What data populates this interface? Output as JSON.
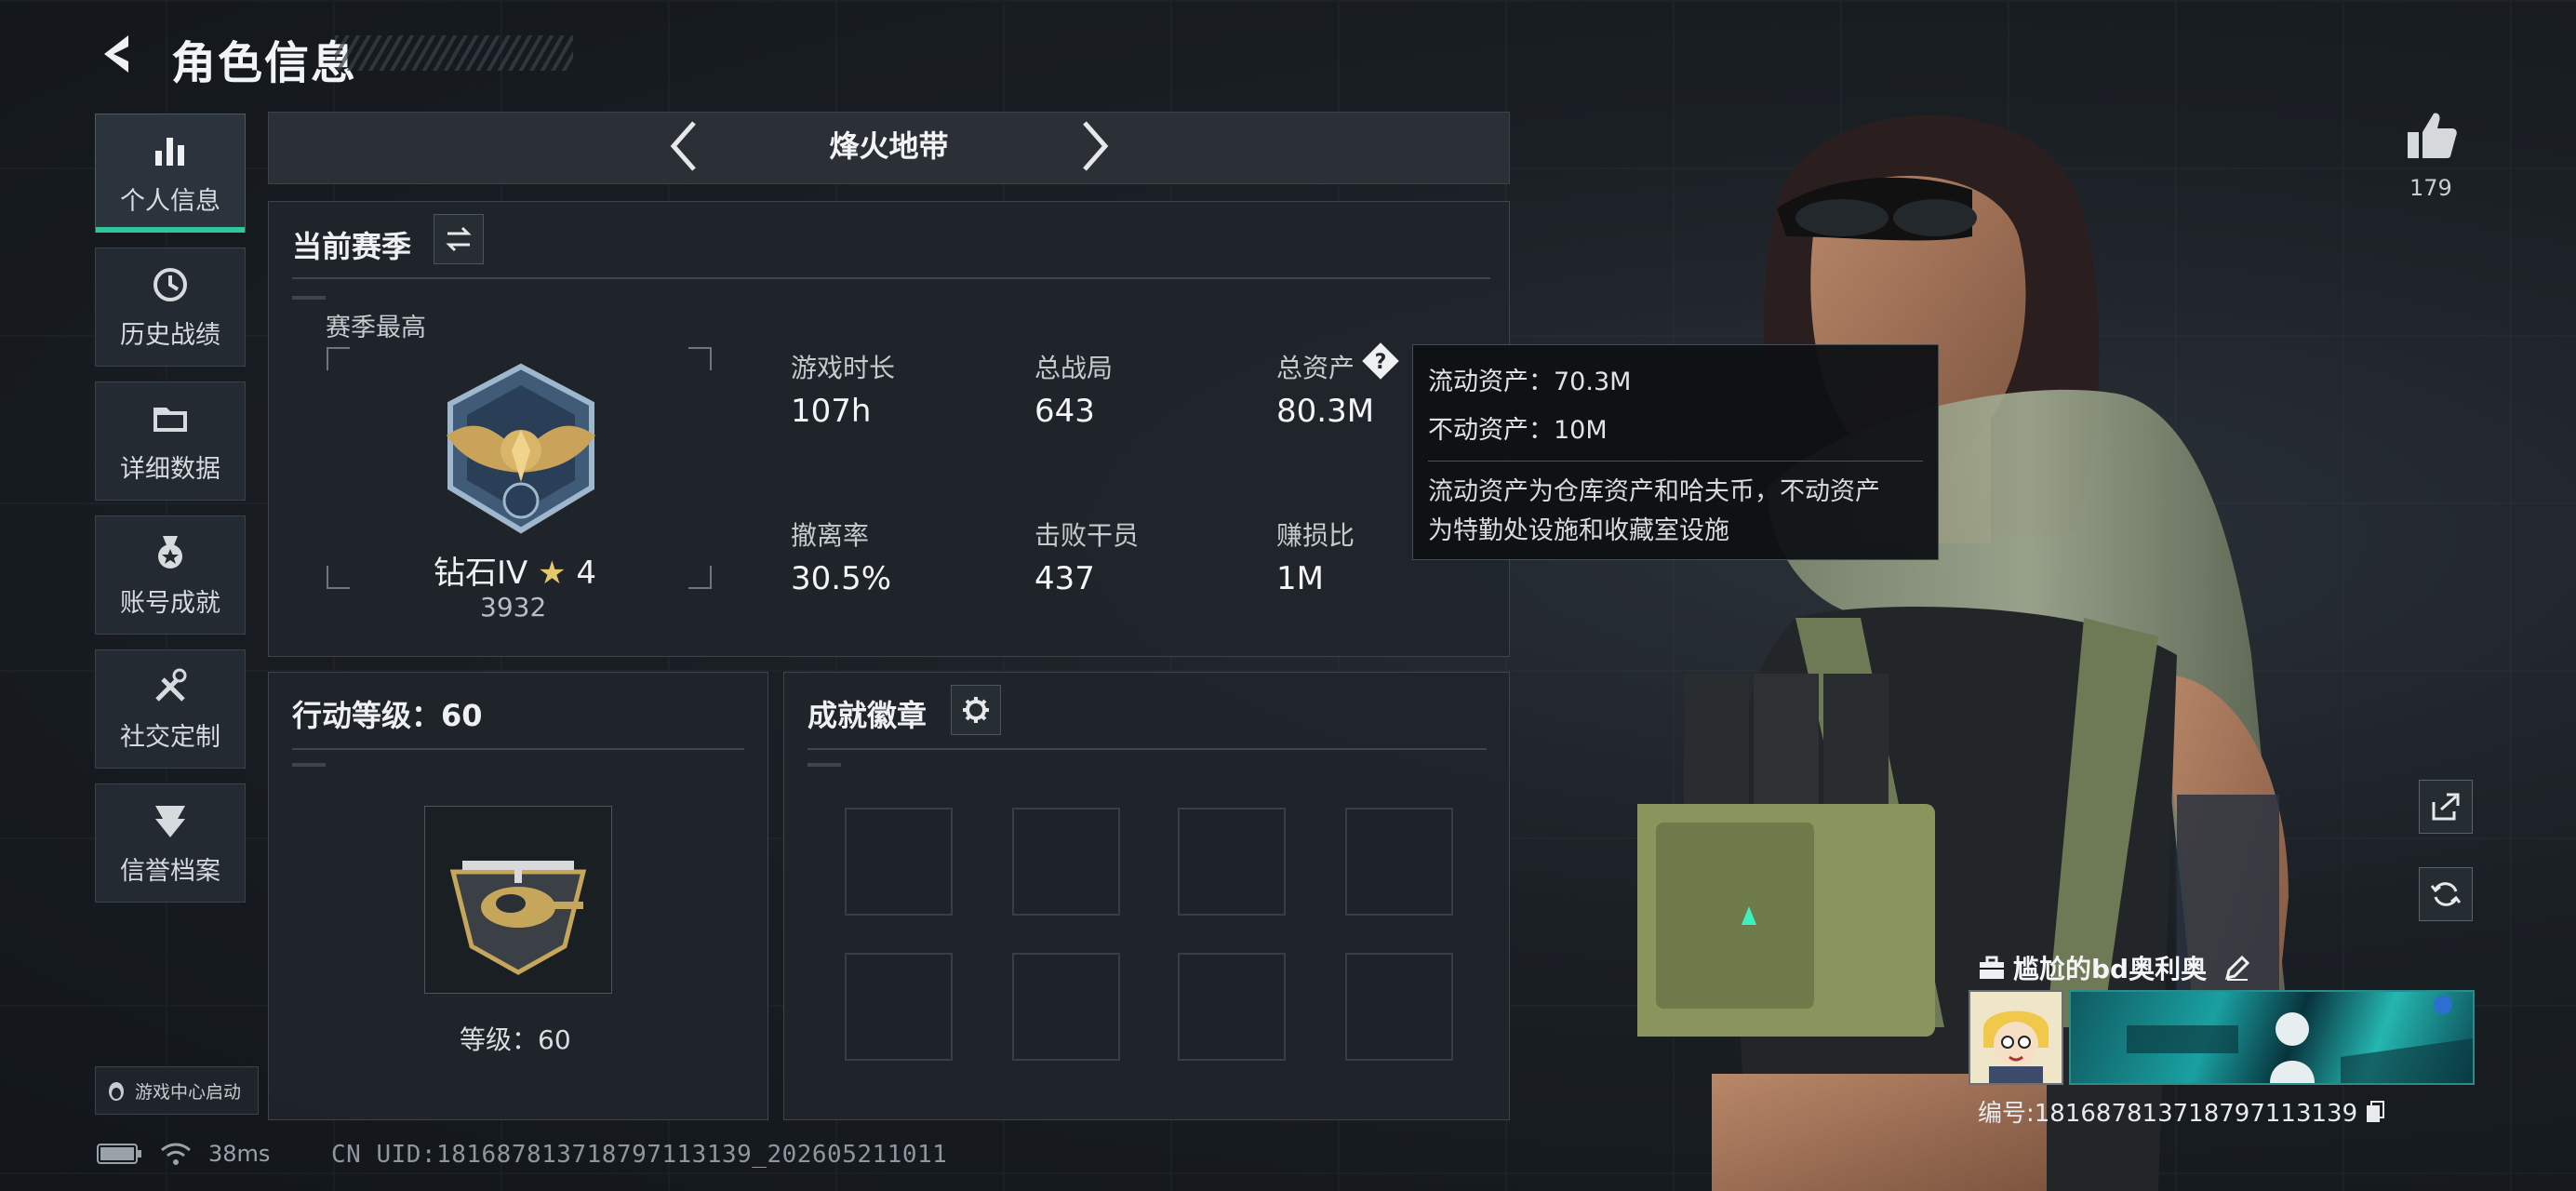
{
  "header": {
    "title": "角色信息"
  },
  "sidebar": {
    "items": [
      {
        "label": "个人信息",
        "icon": "bar-chart-icon",
        "active": true
      },
      {
        "label": "历史战绩",
        "icon": "history-icon"
      },
      {
        "label": "详细数据",
        "icon": "folder-icon"
      },
      {
        "label": "账号成就",
        "icon": "medal-icon"
      },
      {
        "label": "社交定制",
        "icon": "tools-icon"
      },
      {
        "label": "信誉档案",
        "icon": "shield-icon"
      }
    ],
    "launch_badge": "游戏中心启动"
  },
  "mode_selector": {
    "label": "烽火地带"
  },
  "season": {
    "title": "当前赛季",
    "season_high_label": "赛季最高",
    "rank_name": "钻石IV",
    "rank_stars": "4",
    "rank_points": "3932",
    "stats": [
      {
        "label": "游戏时长",
        "value": "107h"
      },
      {
        "label": "总战局",
        "value": "643"
      },
      {
        "label": "总资产",
        "value": "80.3M"
      },
      {
        "label": "撤离率",
        "value": "30.5%"
      },
      {
        "label": "击败干员",
        "value": "437"
      },
      {
        "label": "赚损比",
        "value": "1M"
      }
    ]
  },
  "tooltip": {
    "liquid": "流动资产：70.3M",
    "fixed": "不动资产：10M",
    "desc_line1": "流动资产为仓库资产和哈夫币，不动资产",
    "desc_line2": "为特勤处设施和收藏室设施"
  },
  "action_level": {
    "title": "行动等级：60",
    "level_text": "等级：60"
  },
  "achievements": {
    "title": "成就徽章",
    "slots": 8
  },
  "profile": {
    "likes": "179",
    "player_name": "尴尬的bd奥利奥",
    "player_id": "编号:1816878137187971131​39"
  },
  "status": {
    "ping": "38ms",
    "uid": "CN UID:181687813718797113139_202605211011"
  },
  "colors": {
    "accent": "#2fc79a",
    "panel": "#1f252b",
    "border": "#3b444d"
  }
}
